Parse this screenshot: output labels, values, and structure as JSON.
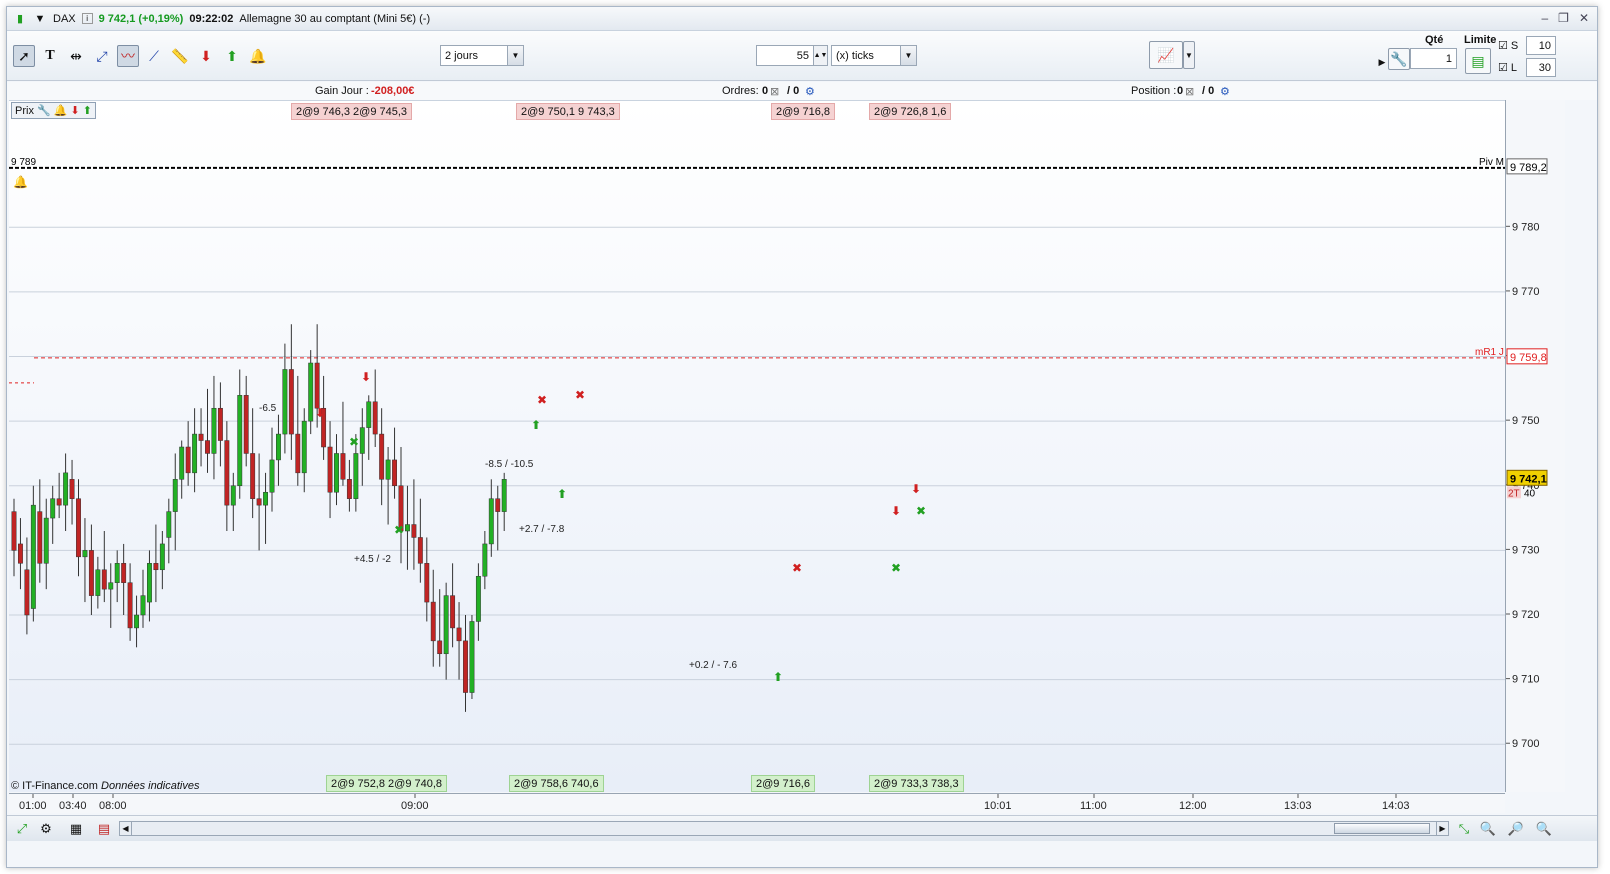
{
  "title": {
    "symbol": "DAX",
    "price": "9 742,1 (+0,19%)",
    "time": "09:22:02",
    "instrument": "Allemagne 30 au comptant (Mini 5€) (-)"
  },
  "toolbar": {
    "period": "2 jours",
    "ticks_value": "55",
    "ticks_unit": "(x) ticks",
    "qty_label": "Qté",
    "qty_value": "1",
    "limit_label": "Limite",
    "s_label": "S",
    "s_value": "10",
    "l_label": "L",
    "l_value": "30"
  },
  "info": {
    "gain_label": "Gain Jour :",
    "gain_value": "-208,00€",
    "orders_label": "Ordres:",
    "orders_a": "0",
    "orders_b": "/ 0",
    "position_label": "Position :",
    "position_a": "0",
    "position_b": "/ 0"
  },
  "prix_label": "Prix",
  "top_chips": [
    "2@9 746,3 2@9 745,3",
    "2@9 750,1 9 743,3",
    "2@9 716,8",
    "2@9 726,8 1,6"
  ],
  "bottom_chips": [
    "2@9 752,8 2@9 740,8",
    "2@9 758,6 740,6",
    "2@9 716,6",
    "2@9 733,3 738,3"
  ],
  "annotations": [
    "-6.5",
    "+4.5 / -2",
    "-8.5 / -10.5",
    "+2.7 / -7.8",
    "+0.2 / - 7.6"
  ],
  "levels": {
    "piv_label_left": "9 789",
    "piv_label_right": "Piv M",
    "piv_value": "9 789,2",
    "mr1_label": "mR1 J",
    "mr1_value": "9 759,8",
    "current_value": "9 742,1",
    "current_sub": "2T",
    "current_sub2": "40"
  },
  "copyright": "© IT-Finance.com",
  "copyright_note": "Données indicatives",
  "colors": {
    "up": "#22b024",
    "down": "#c02424",
    "pivot": "#000000",
    "mr1": "#e02020"
  },
  "chart_data": {
    "type": "candlestick",
    "title": "",
    "ylim": [
      9694,
      9798
    ],
    "y_ticks": [
      9700,
      9710,
      9720,
      9730,
      9740,
      9750,
      9760,
      9770,
      9780
    ],
    "y_tick_labels": [
      "9 700",
      "9 710",
      "9 720",
      "9 730",
      "9 740",
      "9 750",
      "9 760",
      "9 770",
      "9 780"
    ],
    "x_tick_labels": [
      "01:00",
      "03:40",
      "08:00",
      "09:00",
      "10:01",
      "11:00",
      "12:00",
      "13:03",
      "14:03"
    ],
    "hlines": [
      {
        "name": "Piv M",
        "value": 9789.2
      },
      {
        "name": "mR1 J",
        "value": 9759.8
      }
    ],
    "candles": [
      [
        9736,
        9738,
        9726,
        9730
      ],
      [
        9731,
        9735,
        9724,
        9728
      ],
      [
        9727,
        9732,
        9717,
        9720
      ],
      [
        9721,
        9740,
        9719,
        9737
      ],
      [
        9736,
        9741,
        9725,
        9728
      ],
      [
        9728,
        9738,
        9724,
        9735
      ],
      [
        9735,
        9740,
        9731,
        9738
      ],
      [
        9738,
        9742,
        9735,
        9737
      ],
      [
        9737,
        9745,
        9733,
        9742
      ],
      [
        9741,
        9744,
        9734,
        9738
      ],
      [
        9738,
        9741,
        9726,
        9729
      ],
      [
        9729,
        9735,
        9722,
        9730
      ],
      [
        9730,
        9734,
        9720,
        9723
      ],
      [
        9723,
        9729,
        9721,
        9727
      ],
      [
        9727,
        9733,
        9722,
        9724
      ],
      [
        9724,
        9728,
        9718,
        9725
      ],
      [
        9725,
        9730,
        9722,
        9728
      ],
      [
        9728,
        9731,
        9720,
        9725
      ],
      [
        9725,
        9728,
        9716,
        9718
      ],
      [
        9718,
        9723,
        9715,
        9720
      ],
      [
        9720,
        9727,
        9718,
        9723
      ],
      [
        9722,
        9730,
        9719,
        9728
      ],
      [
        9728,
        9734,
        9722,
        9727
      ],
      [
        9727,
        9733,
        9724,
        9731
      ],
      [
        9732,
        9738,
        9728,
        9736
      ],
      [
        9736,
        9745,
        9730,
        9741
      ],
      [
        9741,
        9747,
        9738,
        9746
      ],
      [
        9746,
        9750,
        9740,
        9742
      ],
      [
        9742,
        9752,
        9739,
        9748
      ],
      [
        9748,
        9752,
        9743,
        9747
      ],
      [
        9747,
        9755,
        9742,
        9745
      ],
      [
        9745,
        9757,
        9741,
        9752
      ],
      [
        9752,
        9756,
        9743,
        9747
      ],
      [
        9747,
        9750,
        9733,
        9737
      ],
      [
        9737,
        9742,
        9733,
        9740
      ],
      [
        9740,
        9758,
        9738,
        9754
      ],
      [
        9754,
        9757,
        9743,
        9745
      ],
      [
        9745,
        9752,
        9735,
        9738
      ],
      [
        9738,
        9745,
        9730,
        9737
      ],
      [
        9737,
        9742,
        9731,
        9739
      ],
      [
        9739,
        9749,
        9736,
        9744
      ],
      [
        9744,
        9751,
        9740,
        9748
      ],
      [
        9748,
        9762,
        9745,
        9758
      ],
      [
        9758,
        9765,
        9744,
        9748
      ],
      [
        9748,
        9757,
        9740,
        9742
      ],
      [
        9742,
        9752,
        9739,
        9750
      ],
      [
        9750,
        9761,
        9748,
        9759
      ],
      [
        9759,
        9765,
        9749,
        9752
      ],
      [
        9752,
        9757,
        9744,
        9746
      ],
      [
        9746,
        9750,
        9735,
        9739
      ],
      [
        9739,
        9748,
        9737,
        9745
      ],
      [
        9745,
        9753,
        9740,
        9741
      ],
      [
        9741,
        9744,
        9736,
        9738
      ],
      [
        9738,
        9748,
        9736,
        9745
      ],
      [
        9745,
        9752,
        9740,
        9749
      ],
      [
        9749,
        9754,
        9744,
        9753
      ],
      [
        9753,
        9758,
        9746,
        9748
      ],
      [
        9748,
        9752,
        9737,
        9741
      ],
      [
        9741,
        9746,
        9734,
        9744
      ],
      [
        9744,
        9749,
        9738,
        9740
      ],
      [
        9740,
        9746,
        9728,
        9733
      ],
      [
        9733,
        9740,
        9727,
        9734
      ],
      [
        9734,
        9741,
        9727,
        9732
      ],
      [
        9732,
        9738,
        9725,
        9728
      ],
      [
        9728,
        9732,
        9719,
        9722
      ],
      [
        9722,
        9727,
        9712,
        9716
      ],
      [
        9716,
        9724,
        9712,
        9714
      ],
      [
        9714,
        9725,
        9710,
        9723
      ],
      [
        9723,
        9728,
        9715,
        9718
      ],
      [
        9718,
        9722,
        9710,
        9716
      ],
      [
        9716,
        9720,
        9705,
        9708
      ],
      [
        9708,
        9720,
        9707,
        9719
      ],
      [
        9719,
        9728,
        9716,
        9726
      ],
      [
        9726,
        9733,
        9724,
        9731
      ],
      [
        9731,
        9741,
        9729,
        9738
      ],
      [
        9738,
        9740,
        9730,
        9736
      ],
      [
        9736,
        9742,
        9733,
        9741
      ]
    ]
  }
}
